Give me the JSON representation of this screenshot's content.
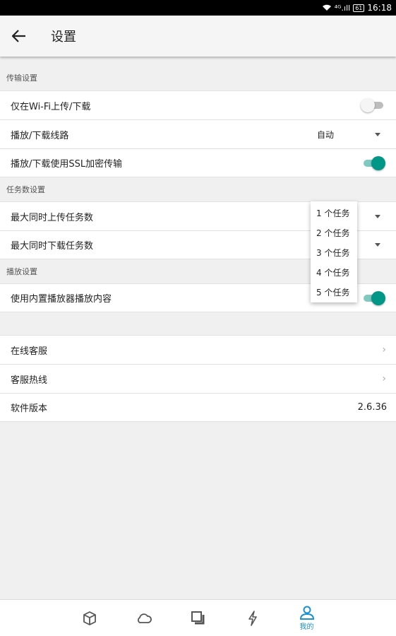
{
  "status_bar": {
    "signal": "⁴ᴳ.ıll",
    "battery": "61",
    "time": "16:18"
  },
  "header": {
    "title": "设置"
  },
  "sections": {
    "transfer": {
      "header": "传输设置",
      "wifi_only_label": "仅在Wi-Fi上传/下载",
      "wifi_only_enabled": false,
      "route_label": "播放/下载线路",
      "route_value": "自动",
      "ssl_label": "播放/下载使用SSL加密传输",
      "ssl_enabled": true
    },
    "tasks": {
      "header": "任务数设置",
      "max_upload_label": "最大同时上传任务数",
      "max_download_label": "最大同时下载任务数"
    },
    "playback": {
      "header": "播放设置",
      "builtin_player_label": "使用内置播放器播放内容",
      "builtin_player_enabled": true
    },
    "misc": {
      "support_label": "在线客服",
      "hotline_label": "客服热线",
      "version_label": "软件版本",
      "version_value": "2.6.36"
    }
  },
  "dropdown": {
    "options": [
      "1 个任务",
      "2 个任务",
      "3 个任务",
      "4 个任务",
      "5 个任务"
    ]
  },
  "bottom_nav": {
    "items": [
      "box-icon",
      "cloud-icon",
      "layers-icon",
      "bolt-icon",
      "user-icon"
    ],
    "active_label": "我的",
    "active_color": "#1a8fd1"
  },
  "colors": {
    "accent": "#009688",
    "accent_track": "#7fc9c0"
  }
}
